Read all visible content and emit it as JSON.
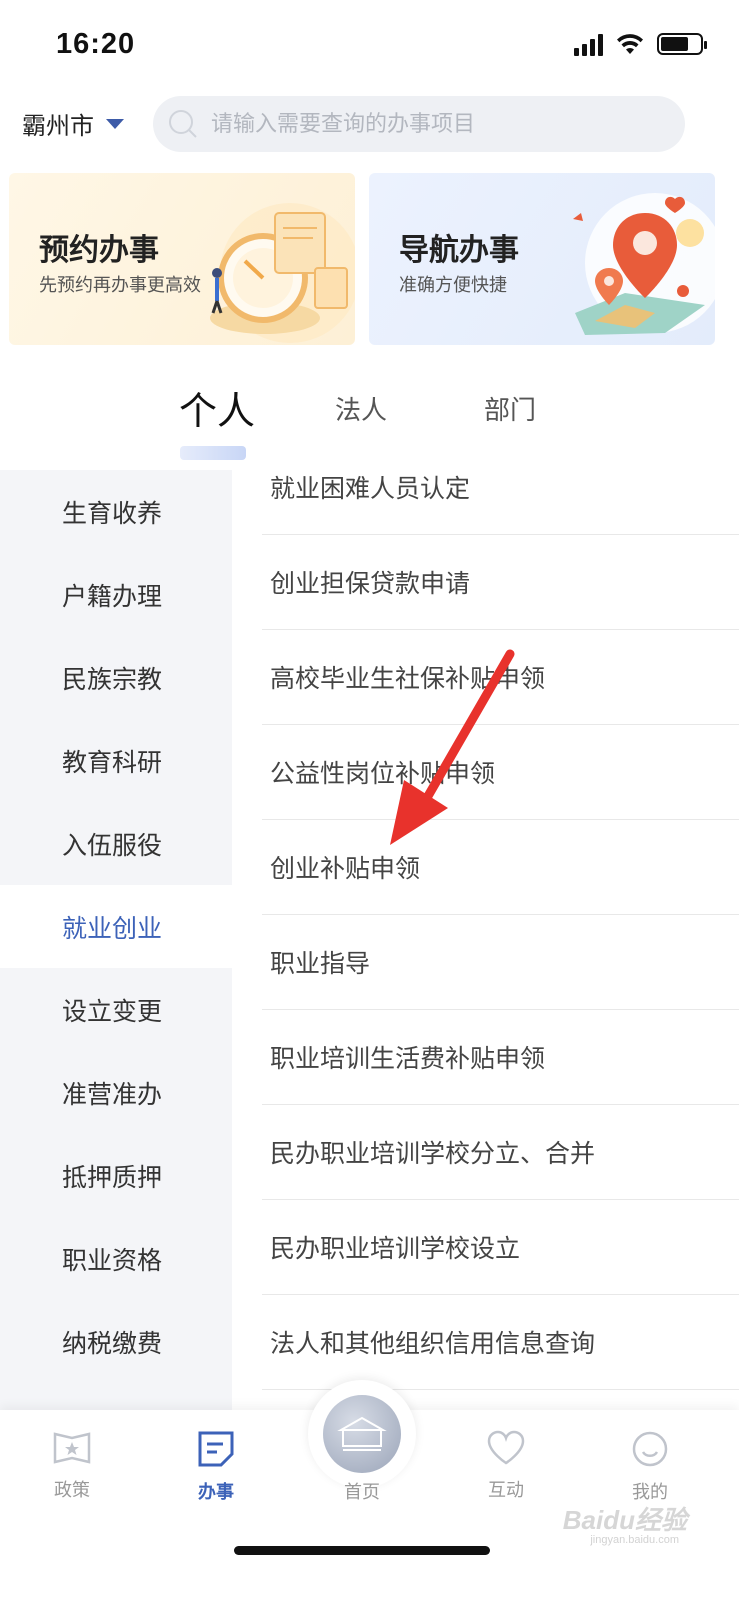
{
  "status": {
    "time": "16:20"
  },
  "header": {
    "city": "霸州市",
    "search_placeholder": "请输入需要查询的办事项目"
  },
  "cards": [
    {
      "title": "预约办事",
      "subtitle": "先预约再办事更高效"
    },
    {
      "title": "导航办事",
      "subtitle": "准确方便快捷"
    }
  ],
  "tabs": [
    {
      "label": "个人",
      "active": true
    },
    {
      "label": "法人",
      "active": false
    },
    {
      "label": "部门",
      "active": false
    }
  ],
  "categories": [
    {
      "label": "生育收养"
    },
    {
      "label": "户籍办理"
    },
    {
      "label": "民族宗教"
    },
    {
      "label": "教育科研"
    },
    {
      "label": "入伍服役"
    },
    {
      "label": "就业创业",
      "active": true
    },
    {
      "label": "设立变更"
    },
    {
      "label": "准营准办"
    },
    {
      "label": "抵押质押"
    },
    {
      "label": "职业资格"
    },
    {
      "label": "纳税缴费"
    }
  ],
  "services": [
    "就业困难人员认定",
    "创业担保贷款申请",
    "高校毕业生社保补贴申领",
    "公益性岗位补贴申领",
    "创业补贴申领",
    "职业指导",
    "职业培训生活费补贴申领",
    "民办职业培训学校分立、合并",
    "民办职业培训学校设立",
    "法人和其他组织信用信息查询"
  ],
  "tabbar": {
    "policy": "政策",
    "affairs": "办事",
    "home": "首页",
    "interact": "互动",
    "mine": "我的"
  },
  "watermark": {
    "brand": "Baidu经验",
    "url": "jingyan.baidu.com"
  },
  "colors": {
    "accent": "#3c62b8",
    "arrow": "#e8322c"
  }
}
